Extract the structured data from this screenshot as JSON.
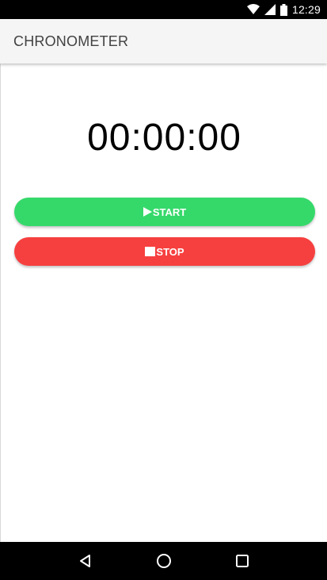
{
  "status_bar": {
    "time": "12:29"
  },
  "app_bar": {
    "title": "CHRONOMETER"
  },
  "timer": {
    "value": "00:00:00"
  },
  "buttons": {
    "start_label": "START",
    "stop_label": "STOP"
  },
  "colors": {
    "start": "#35d96a",
    "stop": "#f6403f",
    "app_bar": "#f5f5f5",
    "title_text": "#424242"
  },
  "icons": {
    "start": "play-icon",
    "stop": "stop-icon",
    "nav": [
      "back-icon",
      "home-icon",
      "recents-icon"
    ]
  }
}
